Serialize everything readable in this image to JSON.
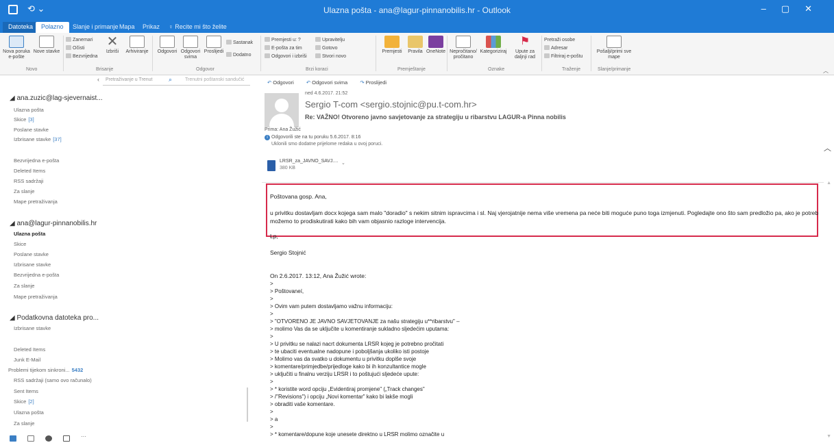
{
  "window": {
    "title": "Ulazna pošta - ana@lagur-pinnanobilis.hr - Outlook",
    "qat": "⟲  ⌄"
  },
  "tabs": [
    {
      "label": "Datoteka"
    },
    {
      "label": "Polazno"
    },
    {
      "label": "Slanje i primanje"
    },
    {
      "label": "Mapa"
    },
    {
      "label": "Prikaz"
    },
    {
      "label": "♀ Recite mi što želite"
    }
  ],
  "ribbon": {
    "new_email": "Nova poruka e-pošte",
    "new_items": "Nove stavke",
    "ignore": "Zanemari",
    "cleanup": "Očisti",
    "junk": "Bezvrijedna",
    "delete": "Izbriši",
    "archive": "Arhiviranje",
    "reply": "Odgovori",
    "reply_all": "Odgovori svima",
    "forward": "Proslijedi",
    "meeting": "Sastanak",
    "more": "Dodatno",
    "quick1": "Premjesti u: ?",
    "quick2": "E-pošta za tim",
    "quick3": "Odgovori i izbriši",
    "quick4": "Upravitelju",
    "quick5": "Gotovo",
    "quick6": "Stvori novo",
    "move": "Premjesti",
    "rules": "Pravila",
    "onenote": "OneNote",
    "unread": "Nepročitano/ pročitano",
    "categorize": "Kategoriziraj",
    "followup": "Upute za daljnji rad",
    "find_contacts": "Pretraži osobe",
    "address_book": "Adresar",
    "filter": "Filtriraj e-poštu",
    "send_receive": "Pošalji/primi sve mape",
    "groups": [
      "Novo",
      "Brisanje",
      "Odgovor",
      "Brzi koraci",
      "Premještanje",
      "Oznake",
      "Traženje",
      "Slanje/primanje"
    ]
  },
  "search": {
    "placeholder": "Pretraživanje u Trenut",
    "scope": "Trenutni poštanski sandučić"
  },
  "folders": {
    "accounts": [
      {
        "name": "◢ ana.zuzic@lag-sjevernaist...",
        "items": [
          {
            "label": "Ulazna pošta",
            "count": ""
          },
          {
            "label": "Skice",
            "count": "[3]"
          },
          {
            "label": "Poslane stavke",
            "count": ""
          },
          {
            "label": "Izbrisane stavke",
            "count": "[37]"
          },
          {
            "label": "Bezvrijedna e-pošta",
            "count": ""
          },
          {
            "label": "Deleted Items",
            "count": ""
          },
          {
            "label": "RSS sadržaji",
            "count": ""
          },
          {
            "label": "Za slanje",
            "count": ""
          },
          {
            "label": "Mape pretraživanja",
            "count": ""
          }
        ]
      },
      {
        "name": "◢ ana@lagur-pinnanobilis.hr",
        "items": [
          {
            "label": "Ulazna pošta",
            "count": ""
          },
          {
            "label": "Skice",
            "count": ""
          },
          {
            "label": "Poslane stavke",
            "count": ""
          },
          {
            "label": "Izbrisane stavke",
            "count": ""
          },
          {
            "label": "Bezvrijedna e-pošta",
            "count": ""
          },
          {
            "label": "Za slanje",
            "count": ""
          },
          {
            "label": "Mape pretraživanja",
            "count": ""
          }
        ]
      },
      {
        "name": "◢ Podatkovna datoteka pro...",
        "items": [
          {
            "label": "Izbrisane stavke",
            "count": ""
          },
          {
            "label": "Deleted Items",
            "count": ""
          },
          {
            "label": "Junk E-Mail",
            "count": ""
          },
          {
            "label": "Problemi tijekom sinkroni...",
            "count": "5432"
          },
          {
            "label": "RSS sadržaji (samo ovo računalo)",
            "count": ""
          },
          {
            "label": "Sent Items",
            "count": ""
          },
          {
            "label": "Skice",
            "count": "[2]"
          },
          {
            "label": "Ulazna pošta",
            "count": ""
          },
          {
            "label": "Za slanje",
            "count": ""
          }
        ]
      }
    ]
  },
  "message": {
    "toolbar": {
      "reply": "Odgovori",
      "reply_all": "Odgovori svima",
      "forward": "Proslijedi"
    },
    "date": "ned 4.6.2017. 21:52",
    "sender": "Sergio T-com <sergio.stojnic@pu.t-com.hr>",
    "subject": "Re: VAŽNO! Otvoreno javno savjetovanje za strategiju u ribarstvu LAGUR-a Pinna nobilis",
    "to": "Prima:   Ana Žužić",
    "replied": "Odgovorili ste na tu poruku 5.6.2017. 8:16",
    "removed_breaks": "Uklonili smo dodatne prijelome redaka u ovoj poruci.",
    "attachment": {
      "name": "LRSR_za_JAVNO_SAVJ....",
      "size": "380 KB",
      "dropdown": "⌄"
    },
    "greeting": "Poštovana gosp. Ana,",
    "para1": "u privitku dostavljam docx kojega sam malo \"doradio\" s nekim sitnim ispravcima i sl. Naj vjerojatnije nema više vremena pa neće biti moguće puno toga izmjenuti. Pogledajte ono što sam predložio pa, ako je potrebno",
    "para2": "možemo to prodiskutirati kako bih vam objasnio razloge intervencija.",
    "signoff": "Lp,",
    "signature": "Sergio Stojnić",
    "quote_header": "On 2.6.2017. 13:12, Ana Žužić wrote:",
    "quote_lines": [
      ">",
      "> Poštovaneí,",
      ">",
      "> Ovim vam putem dostavljamo važnu informaciju:",
      ">",
      "> \"OTVORENO JE JAVNO SAVJETOVANJE za našu strategiju u**ribarstvu\" –",
      "> molimo Vas da se uključite u komentiranje sukladno sljedećim uputama:",
      ">",
      "> U privitku se nalazi nacrt dokumenta LRSR kojeg je potrebno pročitati",
      "> te ubaciti eventualne nadopune i poboljšanja ukoliko isti postoje",
      "> Molimo vas da svatko u dokumentu u privitku doplše svoje",
      "> komentare/primjedbe/prijedloge kako bi ih konzultantice mogle",
      "> uključiti u finalnu verziju LRSR i to poštujući sljedeće upute:",
      ">",
      ">    * koristite word opciju „Evidentiraj promjene\" („Track changes\"",
      ">    /\"Revisions\") i opciju „Novi komentar\" kako bi lakše mogli",
      ">    obraditi vaše komentare.",
      ">",
      "> a",
      ">",
      ">    * komentare/dopune koje unesete direktno u LRSR molimo označite u"
    ]
  },
  "colors": {
    "accent": "#1f7bd6",
    "highlight_box": "#d6294a"
  }
}
